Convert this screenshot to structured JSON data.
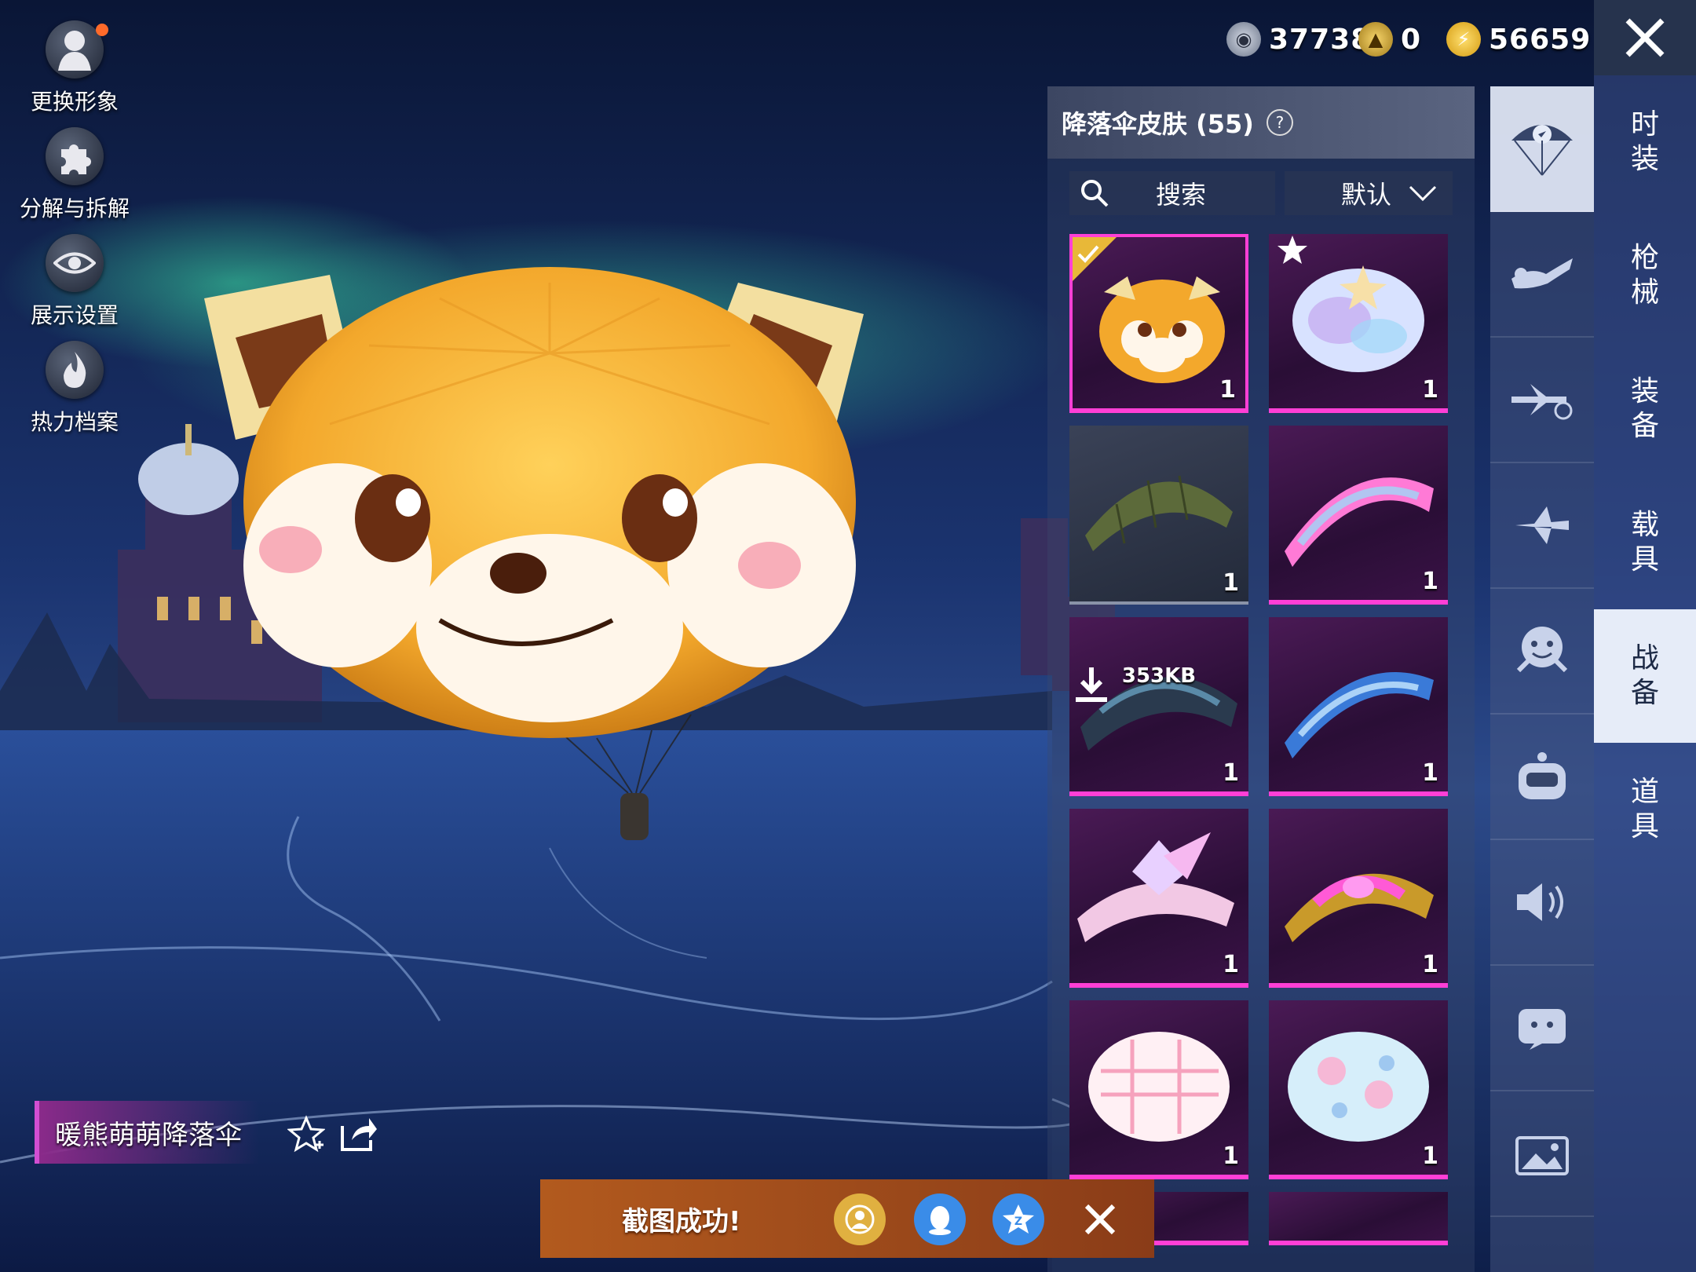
{
  "left_menu": {
    "change_avatar": "更换形象",
    "decompose": "分解与拆解",
    "display_settings": "展示设置",
    "heat_archive": "热力档案"
  },
  "currency": [
    {
      "icon": "silver-coin-icon",
      "value": "37738"
    },
    {
      "icon": "gold-coin-icon",
      "value": "0"
    },
    {
      "icon": "lightning-coin-icon",
      "value": "56659"
    }
  ],
  "panel": {
    "title": "降落伞皮肤 (55)",
    "search_label": "搜索",
    "sort_label": "默认"
  },
  "grid": [
    {
      "count": "1",
      "selected": true,
      "star": false,
      "download": ""
    },
    {
      "count": "1",
      "selected": false,
      "star": true,
      "download": ""
    },
    {
      "count": "1",
      "selected": false,
      "star": false,
      "download": ""
    },
    {
      "count": "1",
      "selected": false,
      "star": false,
      "download": ""
    },
    {
      "count": "1",
      "selected": false,
      "star": false,
      "download": "353KB"
    },
    {
      "count": "1",
      "selected": false,
      "star": false,
      "download": ""
    },
    {
      "count": "1",
      "selected": false,
      "star": false,
      "download": ""
    },
    {
      "count": "1",
      "selected": false,
      "star": false,
      "download": ""
    },
    {
      "count": "1",
      "selected": false,
      "star": false,
      "download": ""
    },
    {
      "count": "1",
      "selected": false,
      "star": false,
      "download": ""
    }
  ],
  "right_nav": [
    "时装",
    "枪械",
    "装备",
    "载具",
    "战备",
    "道具"
  ],
  "right_nav_active": "战备",
  "item_name": "暖熊萌萌降落伞",
  "toast": "截图成功!",
  "colors": {
    "accent": "#ff3fd6",
    "panel": "#3c4662",
    "toast": "#b25a1e"
  }
}
